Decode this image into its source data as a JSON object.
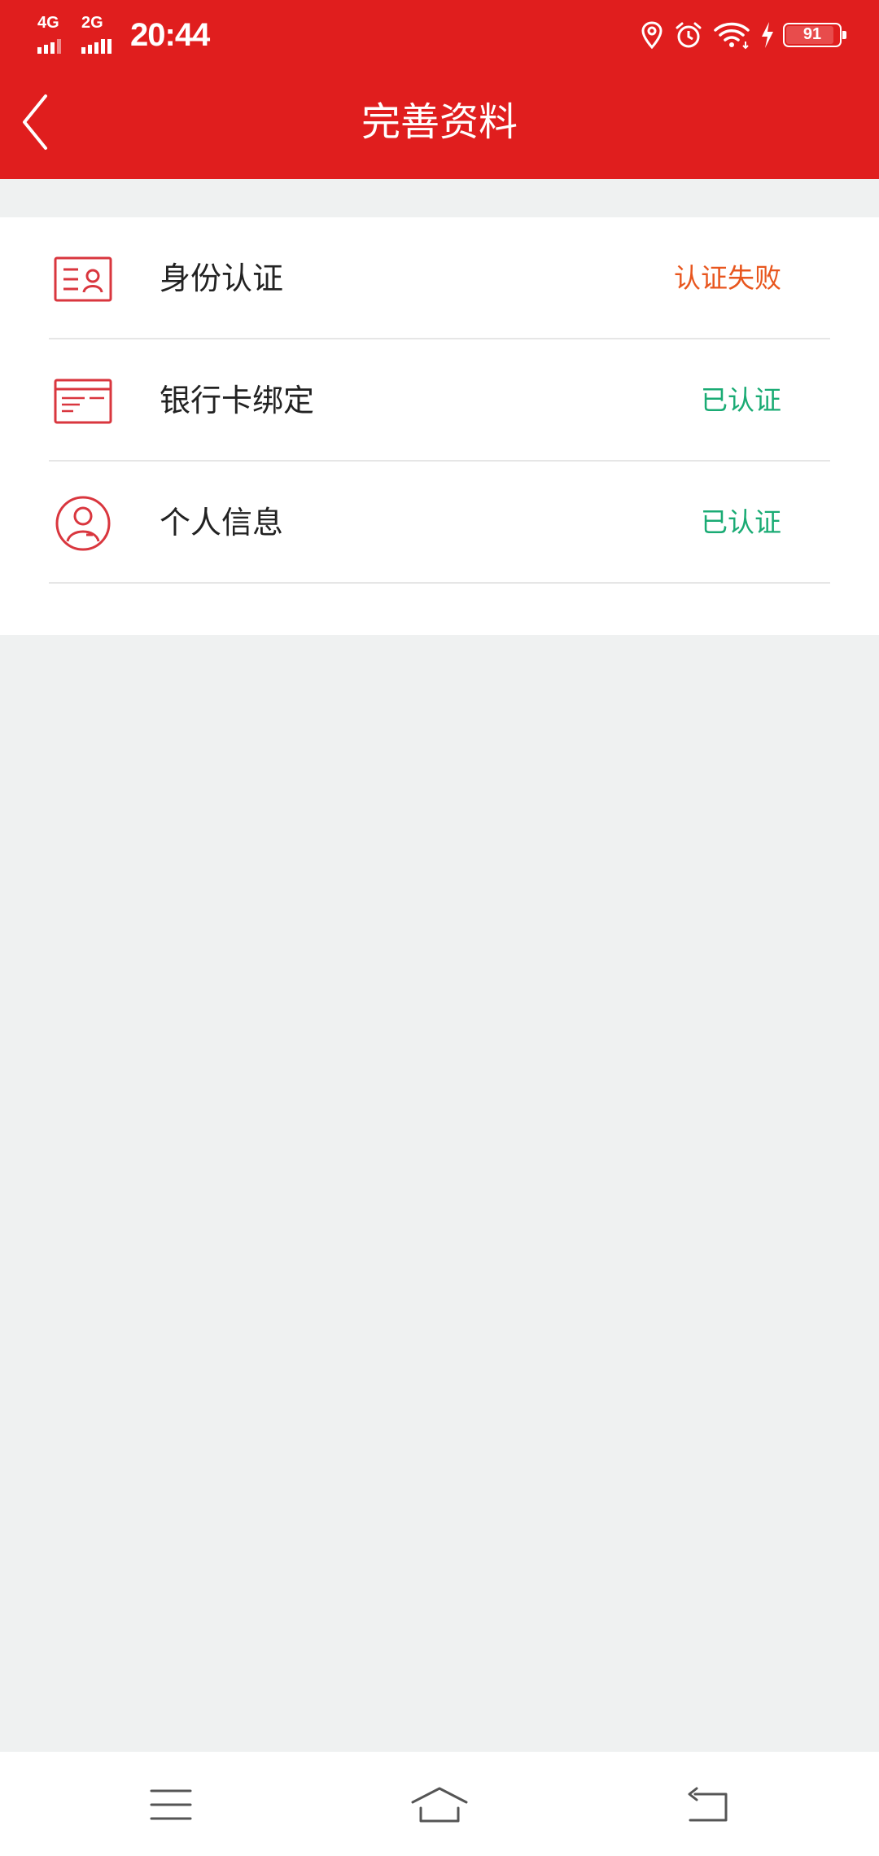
{
  "status_bar": {
    "network_1": "4G",
    "network_2": "2G",
    "time": "20:44",
    "battery_level": "91",
    "battery_fraction": 0.91
  },
  "header": {
    "title": "完善资料"
  },
  "items": [
    {
      "label": "身份认证",
      "status": "认证失败",
      "status_color": "#e8561e",
      "icon": "id-card-icon"
    },
    {
      "label": "银行卡绑定",
      "status": "已认证",
      "status_color": "#1aab74",
      "icon": "bank-card-icon"
    },
    {
      "label": "个人信息",
      "status": "已认证",
      "status_color": "#1aab74",
      "icon": "person-circle-icon"
    }
  ],
  "colors": {
    "brand": "#e01e1e",
    "icon_red": "#d9363e",
    "page_bg": "#eff1f1"
  },
  "bottom_nav": [
    "menu-icon",
    "home-icon",
    "back-icon"
  ]
}
